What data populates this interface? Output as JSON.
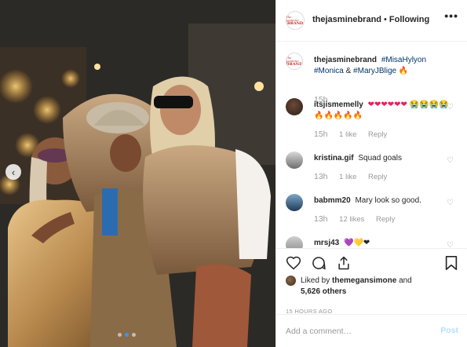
{
  "post": {
    "account": "thejasminebrand",
    "separator": "•",
    "follow_status": "Following",
    "more_label": "•••",
    "logo_text_top": "the jasmine",
    "logo_text_bottom": "BRAND"
  },
  "caption": {
    "user": "thejasminebrand",
    "tag1": "#MisaHylyon",
    "tag2": "#Monica",
    "amp": "&",
    "tag3": "#MaryJBlige",
    "emoji": "🔥",
    "time": "15h"
  },
  "comments": [
    {
      "user": "itsjismemelly",
      "text": "❤❤❤❤❤❤ 😭😭😭😭🔥🔥🔥🔥🔥",
      "time": "15h",
      "likes": "1 like",
      "reply": "Reply"
    },
    {
      "user": "kristina.gif",
      "text": "Squad goals",
      "time": "13h",
      "likes": "1 like",
      "reply": "Reply"
    },
    {
      "user": "babmm20",
      "text": "Mary look so good.",
      "time": "13h",
      "likes": "12 likes",
      "reply": "Reply"
    },
    {
      "user": "mrsj43",
      "text": "💜💛❤"
    }
  ],
  "likes": {
    "prefix": "Liked by",
    "user": "themegansimone",
    "and": "and",
    "count": "5,626 others"
  },
  "timestamp": "15 HOURS AGO",
  "add_comment": {
    "placeholder": "Add a comment…",
    "post_label": "Post"
  },
  "icons": {
    "prev": "‹",
    "heart": "♡"
  },
  "colors": {
    "link_tag": "#003569",
    "accent_blue": "#3897f0",
    "post_disabled": "#b2dffc",
    "muted": "#999999"
  }
}
